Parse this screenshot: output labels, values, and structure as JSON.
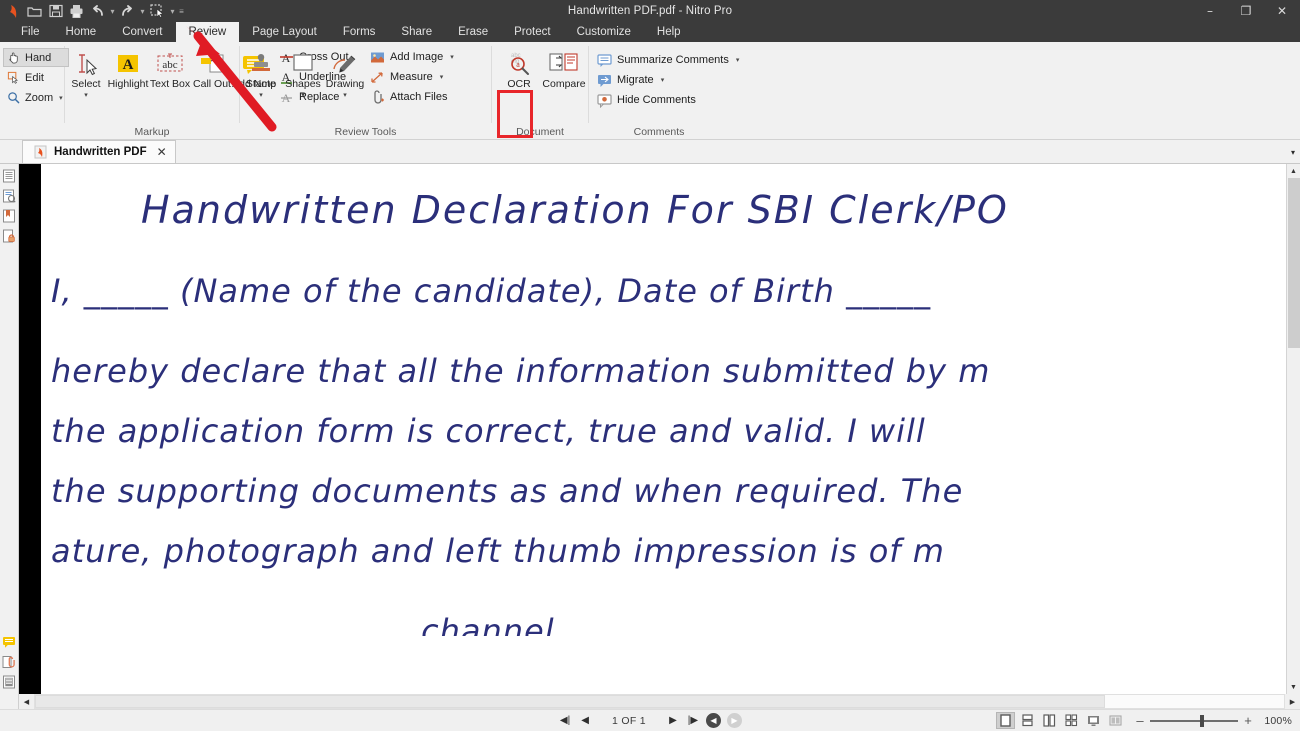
{
  "window": {
    "title": "Handwritten PDF.pdf - Nitro Pro",
    "minimize": "–",
    "maximize": "❐",
    "close": "✕"
  },
  "quick_access": [
    {
      "name": "nitro-logo-icon",
      "label": ""
    },
    {
      "name": "open-icon",
      "label": ""
    },
    {
      "name": "save-icon",
      "label": ""
    },
    {
      "name": "print-icon",
      "label": ""
    },
    {
      "name": "undo-icon",
      "label": ""
    },
    {
      "name": "undo-dropdown-icon",
      "label": "▾"
    },
    {
      "name": "redo-icon",
      "label": ""
    },
    {
      "name": "redo-dropdown-icon",
      "label": "▾"
    },
    {
      "name": "select-tool-icon",
      "label": ""
    },
    {
      "name": "select-dropdown-icon",
      "label": "▾"
    },
    {
      "name": "customize-qat-icon",
      "label": "≡"
    }
  ],
  "tabs": [
    {
      "label": "File",
      "active": false
    },
    {
      "label": "Home",
      "active": false
    },
    {
      "label": "Convert",
      "active": false
    },
    {
      "label": "Review",
      "active": true
    },
    {
      "label": "Page Layout",
      "active": false
    },
    {
      "label": "Forms",
      "active": false
    },
    {
      "label": "Share",
      "active": false
    },
    {
      "label": "Erase",
      "active": false
    },
    {
      "label": "Protect",
      "active": false
    },
    {
      "label": "Customize",
      "active": false
    },
    {
      "label": "Help",
      "active": false
    }
  ],
  "ribbon": {
    "tools_group": {
      "items": [
        {
          "label": "Hand",
          "icon": "hand-icon",
          "selected": true,
          "caret": ""
        },
        {
          "label": "Edit",
          "icon": "edit-icon",
          "selected": false,
          "caret": ""
        },
        {
          "label": "Zoom",
          "icon": "zoom-magnifier-icon",
          "selected": false,
          "caret": "▾"
        }
      ]
    },
    "markup_group": {
      "label": "Markup",
      "buttons": [
        {
          "label": "Select",
          "icon": "text-select-icon",
          "caret": "▾"
        },
        {
          "label": "Highlight",
          "icon": "highlight-icon",
          "caret": ""
        },
        {
          "label": "Text Box",
          "icon": "text-box-icon",
          "caret": ""
        },
        {
          "label": "Call Out",
          "icon": "callout-icon",
          "caret": ""
        },
        {
          "label": "Add Note",
          "icon": "add-note-icon",
          "caret": ""
        }
      ],
      "rows": [
        {
          "label": "Cross Out",
          "icon": "cross-out-icon"
        },
        {
          "label": "Underline",
          "icon": "underline-icon"
        },
        {
          "label": "Replace",
          "icon": "replace-icon"
        }
      ]
    },
    "review_tools_group": {
      "label": "Review Tools",
      "buttons": [
        {
          "label": "Stamp",
          "icon": "stamp-icon",
          "caret": "▾"
        },
        {
          "label": "Shapes",
          "icon": "shapes-icon",
          "caret": "▾"
        },
        {
          "label": "Drawing",
          "icon": "drawing-pencil-icon",
          "caret": "▾"
        }
      ],
      "rows": [
        {
          "label": "Add Image",
          "icon": "add-image-icon",
          "caret": "▾"
        },
        {
          "label": "Measure",
          "icon": "measure-icon",
          "caret": "▾"
        },
        {
          "label": "Attach Files",
          "icon": "attach-files-icon",
          "caret": ""
        }
      ]
    },
    "document_group": {
      "label": "Document",
      "buttons": [
        {
          "label": "OCR",
          "icon": "ocr-icon",
          "caret": "",
          "highlighted": true
        },
        {
          "label": "Compare",
          "icon": "compare-icon",
          "caret": ""
        }
      ]
    },
    "comments_group": {
      "label": "Comments",
      "rows": [
        {
          "label": "Summarize Comments",
          "icon": "summarize-comments-icon",
          "caret": "▾"
        },
        {
          "label": "Migrate",
          "icon": "migrate-icon",
          "caret": "▾"
        },
        {
          "label": "Hide Comments",
          "icon": "hide-comments-icon",
          "caret": ""
        }
      ]
    }
  },
  "doc_tabs": {
    "tabs": [
      {
        "label": "Handwritten PDF",
        "close": "✕",
        "icon": "pdf-file-icon"
      }
    ],
    "overflow_caret": "▾"
  },
  "left_panel_icons": [
    {
      "name": "pages-panel-icon"
    },
    {
      "name": "document-info-panel-icon"
    },
    {
      "name": "bookmarks-panel-icon"
    },
    {
      "name": "security-panel-icon"
    },
    {
      "name": "comments-panel-icon"
    },
    {
      "name": "attachments-panel-icon"
    },
    {
      "name": "layers-panel-icon"
    }
  ],
  "document": {
    "title_line": "Handwritten Declaration For SBI Clerk/PO",
    "lines": [
      "I, _____ (Name of the candidate), Date of Birth _____",
      "hereby declare that all the information submitted by m",
      "the application form is correct, true and valid. I will",
      "the supporting documents as and when required. The",
      "ature, photograph and left thumb impression is of m"
    ],
    "partial_bottom_line": "channel"
  },
  "status_bar": {
    "first_page": "◀|",
    "prev_page": "◀",
    "page_indicator": "1 OF 1",
    "next_page": "▶",
    "last_page": "|▶",
    "prev_view": "◀",
    "next_view": "▶",
    "view_modes": [
      {
        "name": "single-page-view",
        "selected": true
      },
      {
        "name": "continuous-view",
        "selected": false
      },
      {
        "name": "two-page-view",
        "selected": false
      },
      {
        "name": "two-page-continuous-view",
        "selected": false
      },
      {
        "name": "fit-page-view",
        "selected": false
      },
      {
        "name": "fit-width-view",
        "selected": false
      }
    ],
    "zoom_out": "–",
    "zoom_in": "+",
    "zoom_level": "100%"
  },
  "colors": {
    "accent_red": "#e8262a",
    "titlebar": "#3b3b3b",
    "ribbon_bg": "#f1f1f1",
    "ink_blue": "#2b2f7a",
    "highlight_yellow": "#f5c400"
  }
}
